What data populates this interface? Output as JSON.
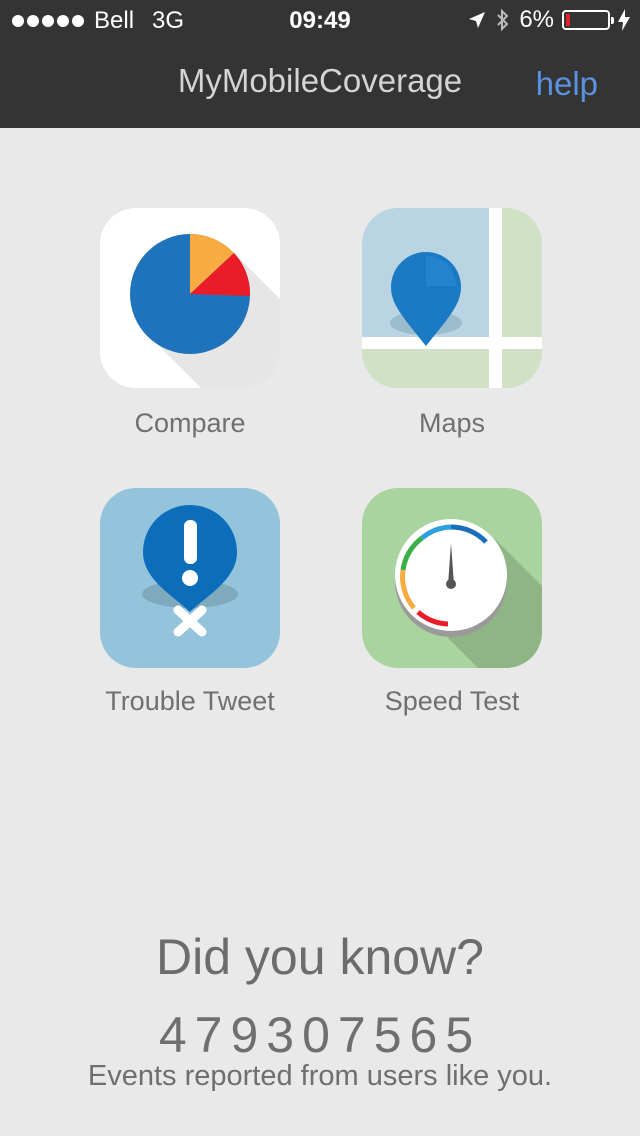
{
  "status_bar": {
    "signal_dots": 5,
    "carrier": "Bell",
    "network": "3G",
    "time": "09:49",
    "battery_text": "6%",
    "battery_level": 0.06,
    "icons": [
      "location-arrow-icon",
      "bluetooth-icon",
      "battery-icon",
      "charging-bolt-icon"
    ]
  },
  "nav": {
    "title": "MyMobileCoverage",
    "help_label": "help",
    "help_color": "#5b92e0"
  },
  "tiles": [
    {
      "label": "Compare",
      "icon": "pie-chart-icon"
    },
    {
      "label": "Maps",
      "icon": "map-pin-icon"
    },
    {
      "label": "Trouble Tweet",
      "icon": "alert-pin-icon"
    },
    {
      "label": "Speed Test",
      "icon": "speedometer-icon"
    }
  ],
  "info": {
    "heading": "Did you know?",
    "counter": "479307565",
    "caption": "Events reported from users like you."
  }
}
